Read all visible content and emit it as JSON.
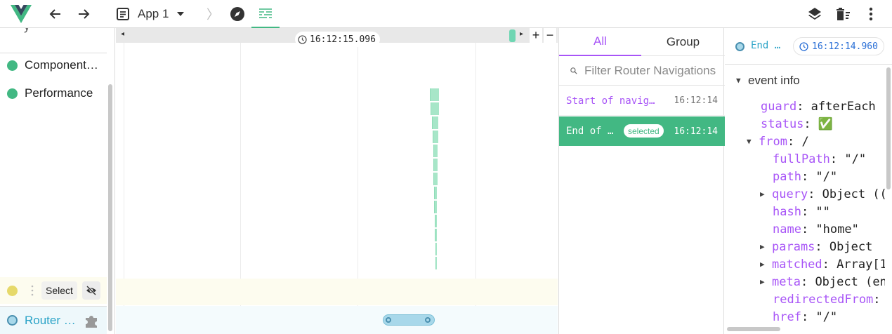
{
  "toolbar": {
    "app_name": "App 1",
    "icons": [
      "vue-logo-icon",
      "arrow-back-icon",
      "arrow-forward-icon",
      "app-icon",
      "chevron-down-icon",
      "breadcrumb-separator",
      "compass-icon",
      "timeline-icon",
      "layers-icon",
      "trash-icon",
      "more-vert-icon"
    ],
    "breadcrumb_sep": "〉"
  },
  "layers": {
    "items": [
      {
        "label": "Component…",
        "color": "#42b883"
      },
      {
        "label": "Performance",
        "color": "#42b883"
      }
    ],
    "select": {
      "label": "Select",
      "color": "#e6d96a"
    },
    "router": {
      "label": "Router …",
      "color": "#a8d8ea"
    }
  },
  "timeline": {
    "cursor_time": "16:12:15.096",
    "zoom_in": "+",
    "zoom_out": "−",
    "arrow_left": "◂",
    "arrow_right": "▸"
  },
  "events": {
    "tabs": {
      "all": "All",
      "group": "Group"
    },
    "filter_placeholder": "Filter Router Navigations",
    "rows": [
      {
        "name": "Start of navig…",
        "time": "16:12:14"
      },
      {
        "name": "End of …",
        "time": "16:12:14",
        "badge": "selected"
      }
    ]
  },
  "inspector": {
    "title": "End …",
    "time": "16:12:14.960",
    "section": "event info",
    "fields": {
      "guard": {
        "key": "guard",
        "value": "afterEach"
      },
      "status": {
        "key": "status",
        "value": "✅"
      },
      "from": {
        "key": "from",
        "value": "/"
      },
      "fullPath": {
        "key": "fullPath",
        "value": "\"/\""
      },
      "path": {
        "key": "path",
        "value": "\"/\""
      },
      "query": {
        "key": "query",
        "value": "Object (("
      },
      "hash": {
        "key": "hash",
        "value": "\"\""
      },
      "name": {
        "key": "name",
        "value": "\"home\""
      },
      "params": {
        "key": "params",
        "value": "Object"
      },
      "matched": {
        "key": "matched",
        "value": "Array[1"
      },
      "meta": {
        "key": "meta",
        "value": "Object (en"
      },
      "redirectedFrom": {
        "key": "redirectedFrom",
        "value": ""
      },
      "href": {
        "key": "href",
        "value": "\"/\""
      }
    }
  },
  "colors": {
    "accent": "#42b883",
    "purple": "#a855f7",
    "router": "#2aa3c7"
  }
}
